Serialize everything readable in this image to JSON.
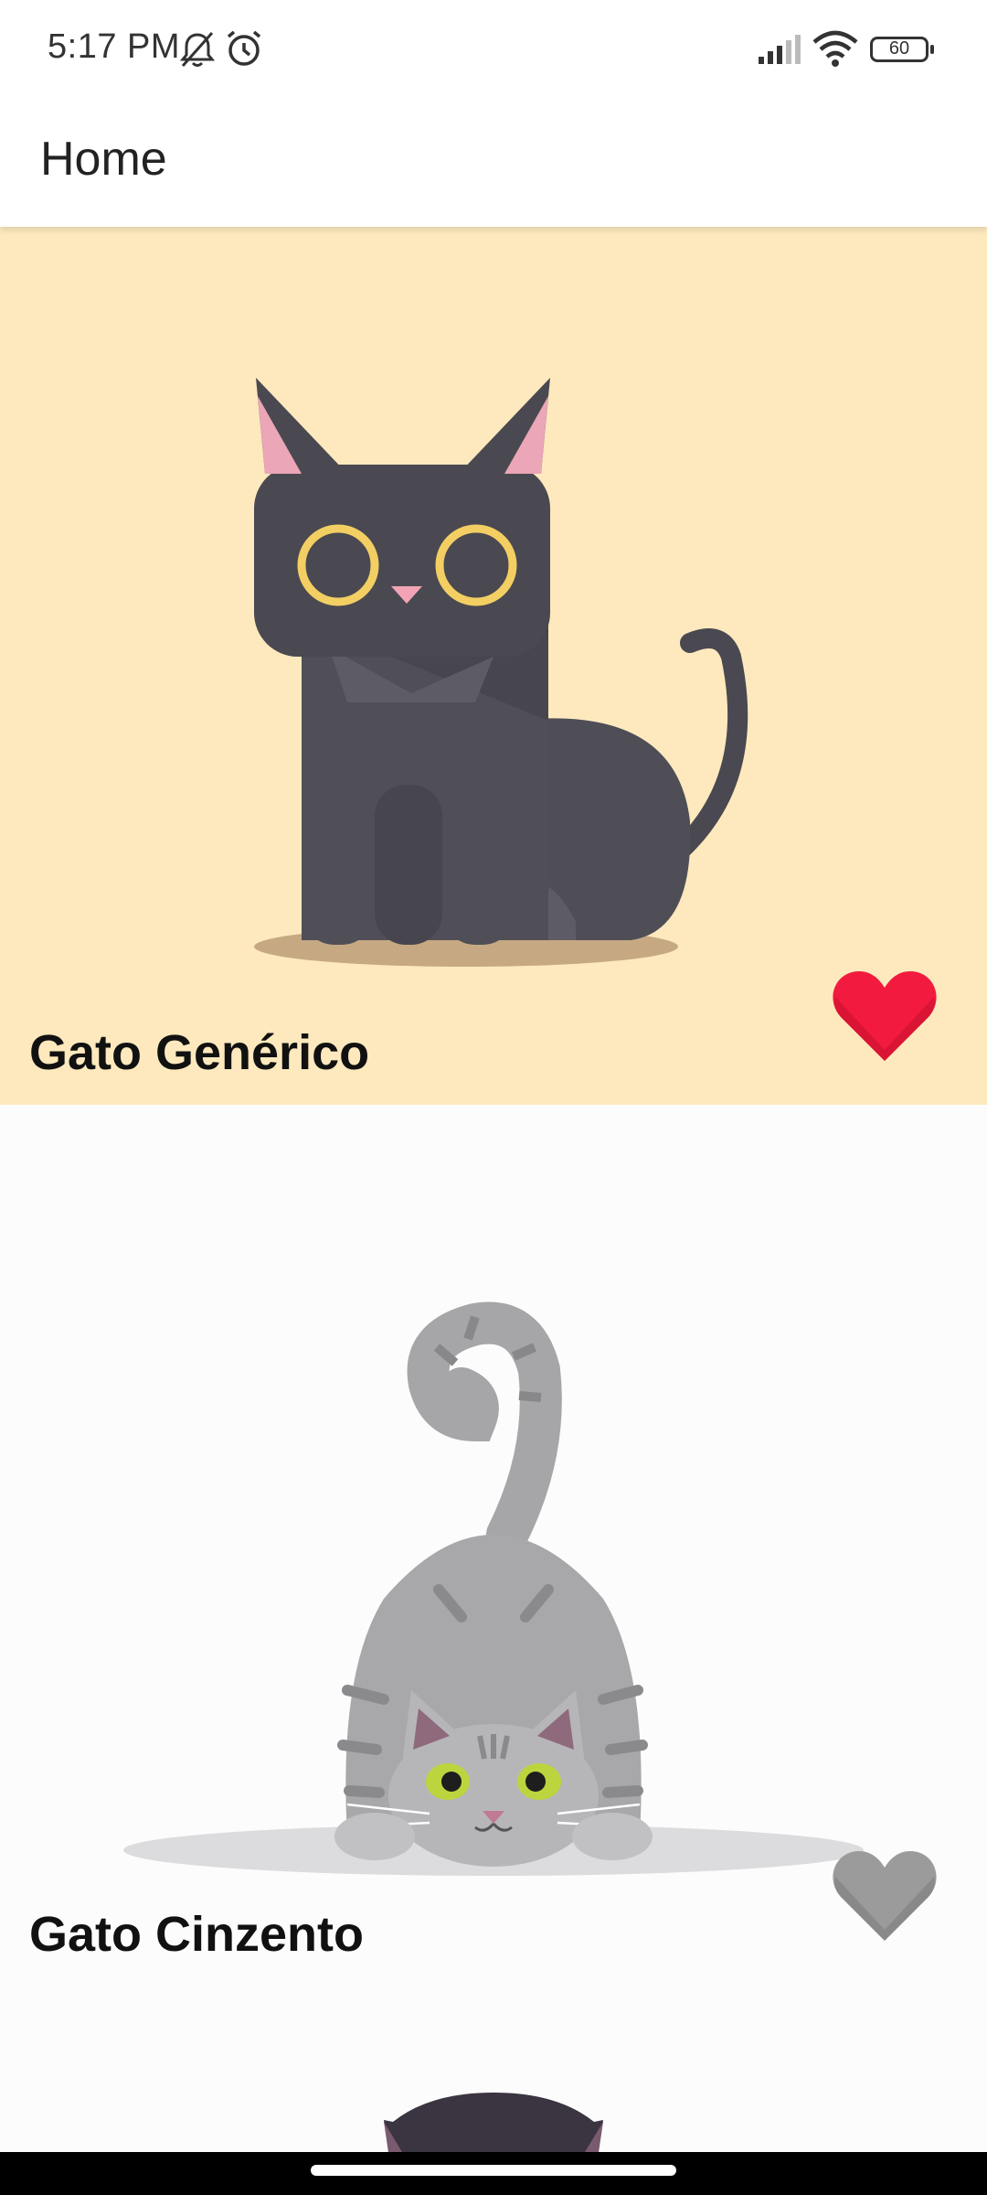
{
  "status_bar": {
    "time": "5:17 PM",
    "battery": "60",
    "icons": [
      "mute-bell-icon",
      "alarm-icon",
      "signal-icon",
      "wifi-icon",
      "battery-icon"
    ]
  },
  "app_bar": {
    "title": "Home"
  },
  "cats": [
    {
      "name": "Gato Genérico",
      "favorite": true,
      "image": "black-cat-illustration",
      "background": "#fde9bd"
    },
    {
      "name": "Gato Cinzento",
      "favorite": false,
      "image": "gray-tabby-cat-illustration",
      "background": "#fcfcfd"
    },
    {
      "name": "",
      "favorite": false,
      "image": "dark-cat-illustration",
      "background": "#fcfcfd"
    }
  ],
  "colors": {
    "favorite_active": "#f21b3f",
    "favorite_inactive": "#9b9b9b"
  }
}
